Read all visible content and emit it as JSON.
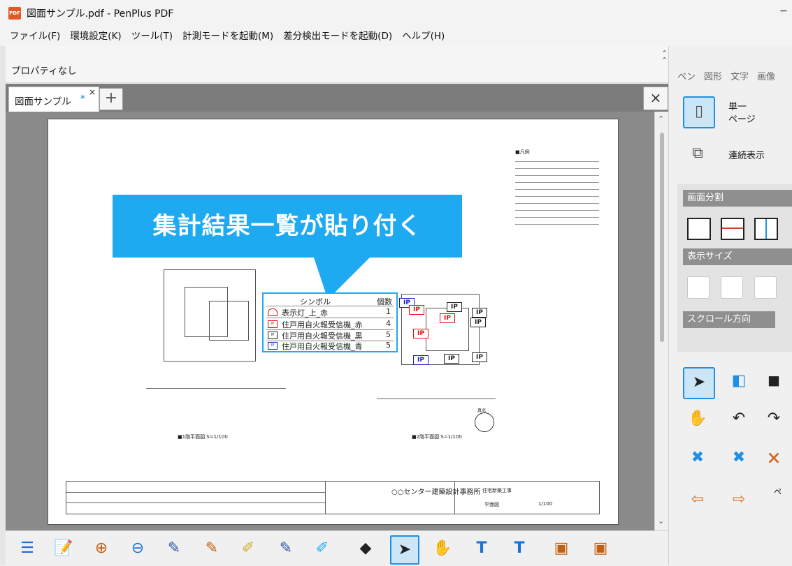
{
  "window": {
    "title": "図面サンプル.pdf - PenPlus PDF",
    "icon_label": "PDF",
    "minimize": "−"
  },
  "menu": [
    "ファイル(F)",
    "環境設定(K)",
    "ツール(T)",
    "計測モードを起動(M)",
    "差分検出モードを起動(D)",
    "ヘルプ(H)"
  ],
  "properties": {
    "label": "プロパティなし"
  },
  "tabs": {
    "doc_label": "図面サンプル",
    "dirty": "*",
    "close": "×",
    "add": "+",
    "close_all": "×"
  },
  "callout": {
    "text": "集計結果一覧が貼り付く"
  },
  "symbol_table": {
    "headers": {
      "symbol": "シンボル",
      "count": "個数"
    },
    "rows": [
      {
        "icon": "",
        "name": "表示灯_上_赤",
        "count": "1"
      },
      {
        "icon": "IP",
        "name": "住戸用自火報受信機_赤",
        "count": "4"
      },
      {
        "icon": "IP",
        "name": "住戸用自火報受信機_黒",
        "count": "5"
      },
      {
        "icon": "IP",
        "name": "住戸用自火報受信機_青",
        "count": "5"
      }
    ]
  },
  "drawing": {
    "ip_label": "IP",
    "plan1_caption": "■1階平面図 S=1/100",
    "plan2_caption": "■2階平面図 S=1/100",
    "north_label": "真北",
    "legend_title": "■凡例",
    "office": "○○センター建築設計事務所",
    "project": "住宅新築工事",
    "sheet_name": "平面図",
    "scale": "1/100"
  },
  "right_panel": {
    "tabs": [
      "ペン",
      "図形",
      "文字",
      "画像"
    ],
    "single_page": "単一\nページ",
    "single_page_l1": "単一",
    "single_page_l2": "ページ",
    "continuous": "連続表示",
    "split_header": "画面分割",
    "size_header": "表示サイズ",
    "scroll_header": "スクロール方向",
    "page_label": "ペ"
  },
  "colors": {
    "accent": "#1eaaf1",
    "active": "#1e90e8",
    "red_symbol": "#dd1111",
    "blue_symbol": "#1a1ad8"
  }
}
